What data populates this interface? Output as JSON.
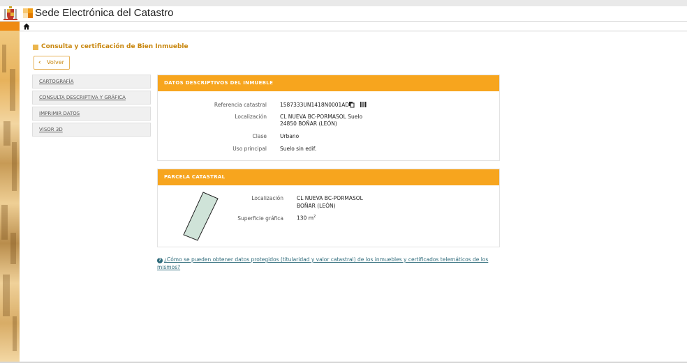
{
  "header": {
    "title": "Sede Electrónica del Catastro",
    "logo_colors": [
      "#f39c12",
      "#f7c873",
      "#e07b00",
      "#fbe3b5"
    ]
  },
  "nav": {
    "home_icon": "home-icon"
  },
  "page": {
    "heading": "Consulta y certificación de Bien Inmueble",
    "back_label": "Volver"
  },
  "menu": {
    "items": [
      {
        "label": "CARTOGRAFÍA"
      },
      {
        "label": "CONSULTA DESCRIPTIVA Y GRÁFICA"
      },
      {
        "label": "IMPRIMIR DATOS"
      },
      {
        "label": "VISOR 3D"
      }
    ]
  },
  "datos": {
    "title": "DATOS DESCRIPTIVOS DEL INMUEBLE",
    "referencia_label": "Referencia catastral",
    "referencia_value": "1587333UN1418N0001AD",
    "localizacion_label": "Localización",
    "localizacion_line1": "CL NUEVA BC-PORMASOL Suelo",
    "localizacion_line2": "24850 BOÑAR (LEÓN)",
    "clase_label": "Clase",
    "clase_value": "Urbano",
    "uso_label": "Uso principal",
    "uso_value": "Suelo sin edif."
  },
  "parcela": {
    "title": "PARCELA CATASTRAL",
    "localizacion_label": "Localización",
    "localizacion_line1": "CL NUEVA BC-PORMASOL",
    "localizacion_line2": "BOÑAR (LEÓN)",
    "superficie_label": "Superficie gráfica",
    "superficie_value": "130 m",
    "superficie_unit_sup": "2",
    "shape_fill": "#cfe3d8"
  },
  "help": {
    "icon": "question-circle-icon",
    "link_text": "¿Cómo se pueden obtener datos protegidos (titularidad y valor catastral) de los inmuebles y certificados telemáticos de los mismos?"
  },
  "colors": {
    "accent": "#f7a51e",
    "heading": "#c8860d",
    "link": "#2d6a7a"
  }
}
